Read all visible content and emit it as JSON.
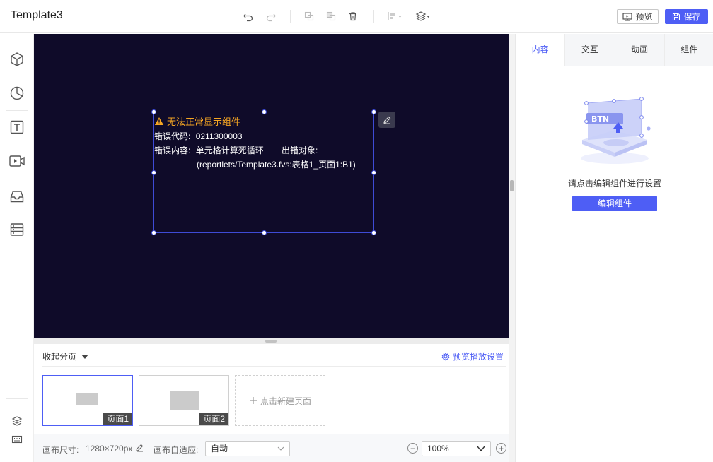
{
  "app": {
    "title": "Template3"
  },
  "toolbar": {
    "preview_label": "预览",
    "save_label": "保存",
    "icons": [
      "undo-icon",
      "redo-icon",
      "copy-icon",
      "paste-icon",
      "delete-icon",
      "align-icon",
      "layers-icon"
    ]
  },
  "sidebar": {
    "items": [
      "3d-cube-icon",
      "pie-chart-icon",
      "text-icon",
      "video-icon",
      "inbox-icon",
      "list-icon"
    ],
    "bottom": [
      "layers-icon",
      "keyboard-icon"
    ]
  },
  "widget": {
    "error_title": "无法正常显示组件",
    "error_code_label": "错误代码:",
    "error_code": "0211300003",
    "error_content_label": "错误内容:",
    "error_content": "单元格计算死循环",
    "error_object_label": "出错对象:",
    "error_object": "(reportlets/Template3.fvs:表格1_页面1:B1)"
  },
  "pages": {
    "collapse_label": "收起分页",
    "preview_setting_label": "预览播放设置",
    "items": [
      {
        "label": "页面1",
        "active": true
      },
      {
        "label": "页面2",
        "active": false
      }
    ],
    "new_page_label": "点击新建页面"
  },
  "status": {
    "canvas_size_label": "画布尺寸:",
    "canvas_size": "1280×720px",
    "adapt_label": "画布自适应:",
    "adapt_value": "自动",
    "zoom": "100%"
  },
  "right_panel": {
    "tabs": [
      "内容",
      "交互",
      "动画",
      "组件"
    ],
    "active_tab": "内容",
    "illustration_text": "BTN",
    "hint": "请点击编辑组件进行设置",
    "edit_button_label": "编辑组件"
  },
  "colors": {
    "accent": "#4e5ef5",
    "canvas_bg": "#0f0b29",
    "warning": "#f5a623"
  }
}
